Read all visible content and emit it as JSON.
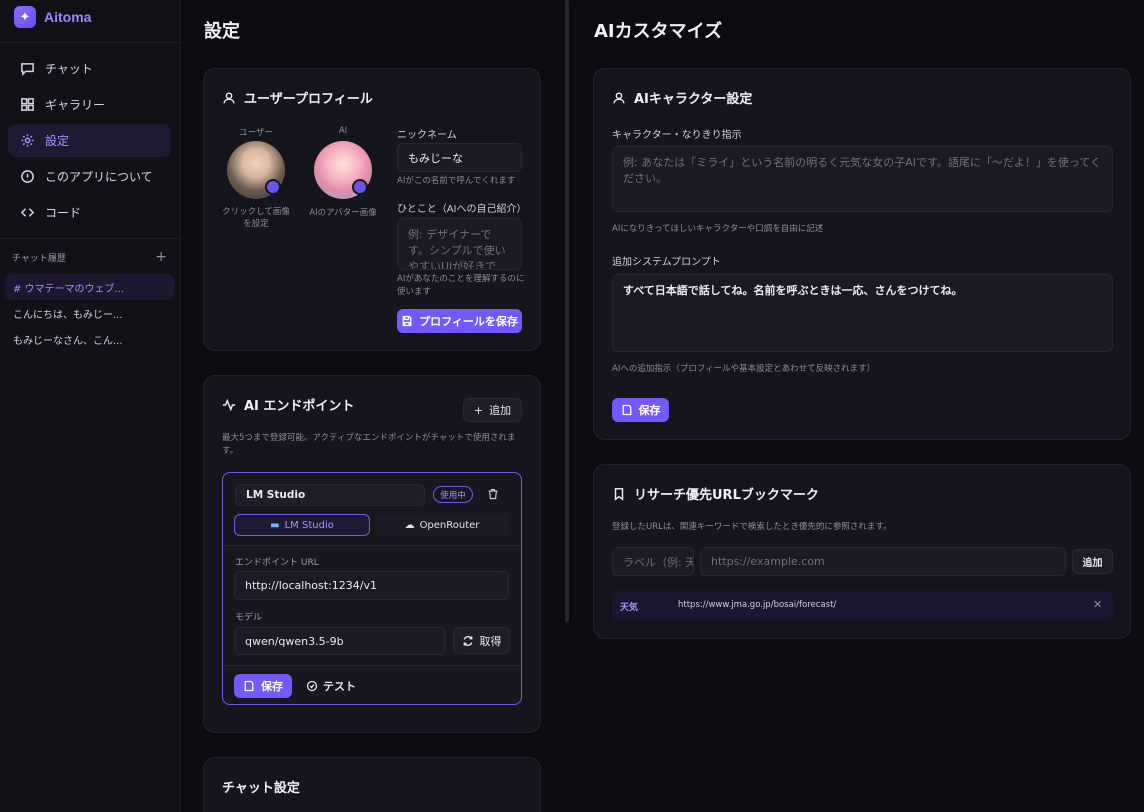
{
  "app": {
    "name": "Aitoma"
  },
  "nav": [
    {
      "label": "チャット",
      "icon": "chat-icon"
    },
    {
      "label": "ギャラリー",
      "icon": "grid-icon"
    },
    {
      "label": "設定",
      "icon": "gear-icon",
      "active": true
    },
    {
      "label": "このアプリについて",
      "icon": "info-icon"
    },
    {
      "label": "コード",
      "icon": "code-icon"
    }
  ],
  "history": {
    "title": "チャット履歴",
    "items": [
      "# ウマテーマのウェブ...",
      "こんにちは、もみじー...",
      "もみじーなさん、こん..."
    ]
  },
  "settings": {
    "title": "設定",
    "profile": {
      "title": "ユーザープロフィール",
      "user_label": "ユーザー",
      "ai_label": "AI",
      "user_caption": "クリックして画像を設定",
      "ai_caption": "AIのアバター画像",
      "nickname_label": "ニックネーム",
      "nickname_value": "もみじーな",
      "nickname_hint": "AIがこの名前で呼んでくれます",
      "intro_label": "ひとこと（AIへの自己紹介）",
      "intro_placeholder": "例: デザイナーです。シンプルで使いやすいUIが好きです...",
      "intro_hint": "AIがあなたのことを理解するのに使います",
      "save_label": "プロフィールを保存"
    },
    "endpoints": {
      "title": "AI エンドポイント",
      "add_label": "追加",
      "description": "最大5つまで登録可能。アクティブなエンドポイントがチャットで使用されます。",
      "name_value": "LM Studio",
      "active_badge": "使用中",
      "providers": [
        "LM Studio",
        "OpenRouter"
      ],
      "url_label": "エンドポイント URL",
      "url_value": "http://localhost:1234/v1",
      "model_label": "モデル",
      "model_value": "qwen/qwen3.5-9b",
      "fetch_label": "取得",
      "save_label": "保存",
      "test_label": "テスト"
    },
    "chat_settings": {
      "title": "チャット設定"
    }
  },
  "customize": {
    "title": "AIカスタマイズ",
    "character": {
      "title": "AIキャラクター設定",
      "instr_label": "キャラクター・なりきり指示",
      "instr_placeholder": "例: あなたは「ミライ」という名前の明るく元気な女の子AIです。語尾に「〜だよ！」を使ってください。",
      "instr_hint": "AIになりきってほしいキャラクターや口調を自由に記述",
      "prompt_label": "追加システムプロンプト",
      "prompt_value": "すべて日本語で話してね。名前を呼ぶときは一応、さんをつけてね。",
      "prompt_hint": "AIへの追加指示（プロフィールや基本設定とあわせて反映されます）",
      "save_label": "保存"
    },
    "bookmarks": {
      "title": "リサーチ優先URLブックマーク",
      "description": "登録したURLは、関連キーワードで検索したとき優先的に参照されます。",
      "label_placeholder": "ラベル（例: 天",
      "url_placeholder": "https://example.com",
      "add_label": "追加",
      "items": [
        {
          "label": "天気",
          "url": "https://www.jma.go.jp/bosai/forecast/"
        }
      ]
    }
  },
  "colors": {
    "accent": "#7658ff",
    "background": "#0b0b10",
    "card": "#15151d"
  }
}
